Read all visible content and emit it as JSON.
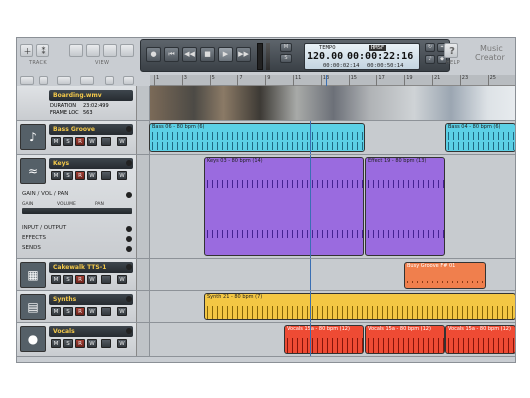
{
  "toolbar": {
    "track_label": "TRACK",
    "view_label": "VIEW",
    "help_label": "HELP",
    "brand": [
      "Music",
      "Creator"
    ]
  },
  "transport": {
    "tempo": "120.00",
    "time_main": "00:00:22:16",
    "time_a": "00:00:02:14",
    "time_b": "00:00:50:14",
    "lcd_tempo": "TEMPO",
    "lcd_mode": "HMSF"
  },
  "ruler": [
    "1",
    "3",
    "5",
    "7",
    "9",
    "11",
    "13",
    "15",
    "17",
    "19",
    "21",
    "23",
    "25"
  ],
  "video": {
    "name": "Boarding.wmv",
    "duration_label": "DURATION",
    "duration": "23:02:499",
    "frameloc_label": "FRAME LOC",
    "frameloc": "563"
  },
  "tracks": [
    {
      "name": "Bass Groove",
      "color": "#5cd0e6",
      "clips": [
        "Bass 06 - 80 bpm (6)",
        "Bass 04 - 80 bpm (6)"
      ]
    },
    {
      "name": "Keys",
      "color": "#9a6bdf",
      "clips": [
        "Keys 03 - 80 bpm (14)",
        "Effect 19 - 80 bpm (13)"
      ],
      "sections": {
        "gvp": "GAIN / VOL / PAN",
        "gain": "GAIN",
        "volume": "VOLUME",
        "pan": "PAN",
        "io": "INPUT / OUTPUT",
        "effects": "EFFECTS",
        "sends": "SENDS"
      }
    },
    {
      "name": "Cakewalk TTS-1",
      "color": "#f07f4d",
      "clips": [
        "Busy Groove F# 01"
      ]
    },
    {
      "name": "Synths",
      "color": "#f4c744",
      "clips": [
        "Synth 21 - 80 bpm (7)"
      ]
    },
    {
      "name": "Vocals",
      "color": "#ee4b34",
      "clips": [
        "Vocals 15a - 80 bpm (12)",
        "Vocals 15a - 80 bpm (12)",
        "Vocals 15a - 80 bpm (12)"
      ]
    }
  ],
  "track_buttons": {
    "m": "M",
    "s": "S",
    "r": "R",
    "w": "W"
  }
}
